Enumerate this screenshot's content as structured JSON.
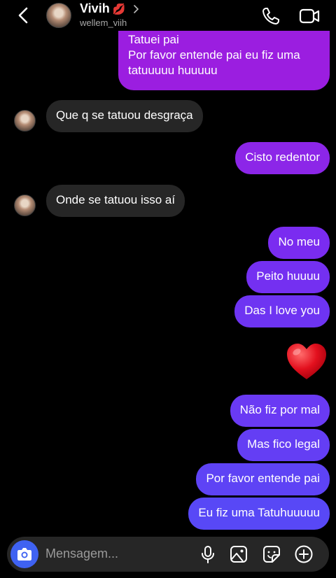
{
  "header": {
    "name": "Vivih",
    "name_emoji": "💋",
    "username": "wellem_viih",
    "icons": [
      "back-chevron-icon",
      "chevron-right-icon",
      "phone-icon",
      "video-icon"
    ]
  },
  "messages": [
    {
      "from": "me",
      "lines": [
        "Tatuei pai",
        "Por favor entende pai eu fiz uma",
        "tatuuuuu huuuuu"
      ],
      "color": "#9b1ee0"
    },
    {
      "from": "them",
      "lines": [
        "Que q se tatuou desgraça"
      ]
    },
    {
      "from": "me",
      "lines": [
        "Cisto redentor"
      ],
      "color": "#8c26e8"
    },
    {
      "from": "them",
      "lines": [
        "Onde se tatuou isso aí"
      ]
    },
    {
      "from": "me",
      "lines": [
        "No meu"
      ],
      "color": "#7a2cf0"
    },
    {
      "from": "me",
      "lines": [
        "Peito huuuu"
      ],
      "color": "#7430f1"
    },
    {
      "from": "me",
      "lines": [
        "Das I love you"
      ],
      "color": "#6e34f2"
    },
    {
      "from": "me",
      "emoji": "❤️"
    },
    {
      "from": "me",
      "lines": [
        "Não fiz por mal"
      ],
      "color": "#6a3af4"
    },
    {
      "from": "me",
      "lines": [
        "Mas fico legal"
      ],
      "color": "#643ef4"
    },
    {
      "from": "me",
      "lines": [
        "Por favor entende pai"
      ],
      "color": "#5e43f5"
    },
    {
      "from": "me",
      "lines": [
        "Eu fiz uma Tatuhuuuuu"
      ],
      "color": "#5848f6"
    }
  ],
  "composer": {
    "placeholder": "Mensagem...",
    "icons": [
      "camera-icon",
      "microphone-icon",
      "gallery-icon",
      "sticker-icon",
      "plus-icon"
    ],
    "camera_color": "#3f62f2"
  }
}
